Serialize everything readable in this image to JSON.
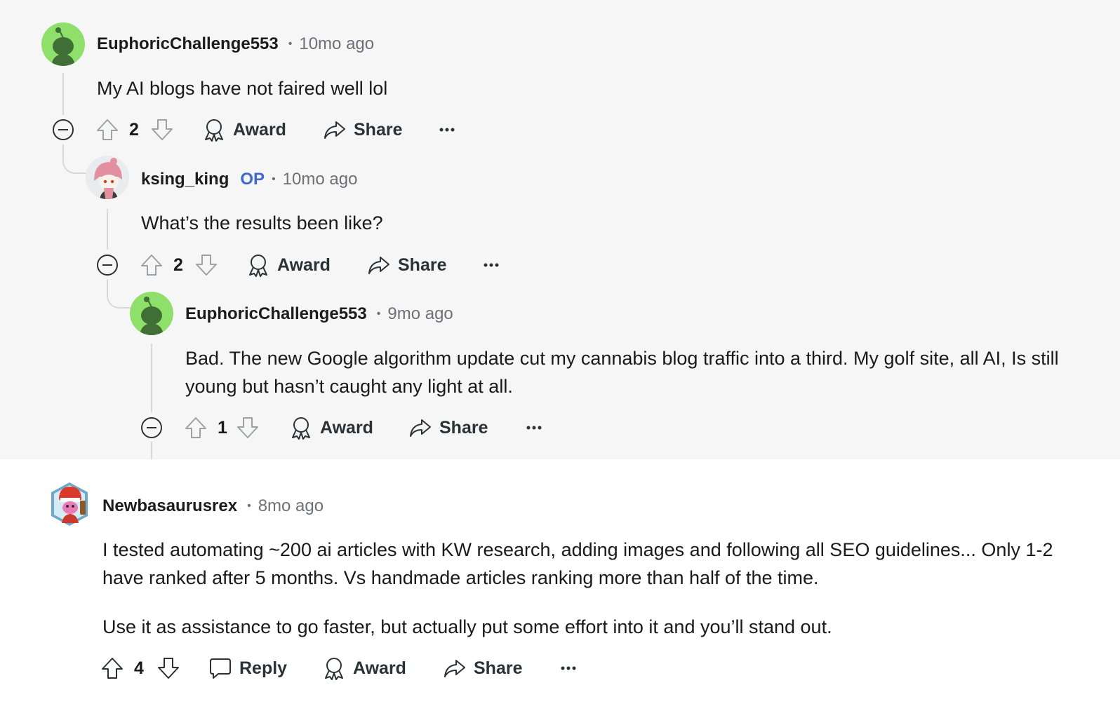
{
  "labels": {
    "award": "Award",
    "share": "Share",
    "reply": "Reply",
    "op_badge": "OP",
    "separator": "•"
  },
  "comments": [
    {
      "author": "EuphoricChallenge553",
      "time": "10mo ago",
      "body": "My AI blogs have not faired well lol",
      "score": "2"
    },
    {
      "author": "ksing_king",
      "is_op": true,
      "time": "10mo ago",
      "body": "What’s the results been like?",
      "score": "2"
    },
    {
      "author": "EuphoricChallenge553",
      "time": "9mo ago",
      "body": "Bad. The new Google algorithm update cut my cannabis blog traffic into a third. My golf site, all AI, Is still young but hasn’t caught any light at all.",
      "score": "1"
    },
    {
      "author": "Newbasaurusrex",
      "time": "8mo ago",
      "body": [
        "I tested automating ~200 ai articles with KW research, adding images and following all SEO guidelines... Only 1-2 have ranked after 5 months. Vs handmade articles ranking more than half of the time.",
        "Use it as assistance to go faster, but actually put some effort into it and you’ll stand out."
      ],
      "score": "4"
    }
  ],
  "icons": [
    "upvote-icon",
    "downvote-icon",
    "award-icon",
    "share-icon",
    "reply-icon",
    "more-icon",
    "collapse-icon",
    "avatar-icon"
  ],
  "colors": {
    "thread_background": "#f6f6f7",
    "op_badge": "#3d6acf",
    "avatar_green": "#8fe06a",
    "thread_line": "#d5d9dc"
  }
}
